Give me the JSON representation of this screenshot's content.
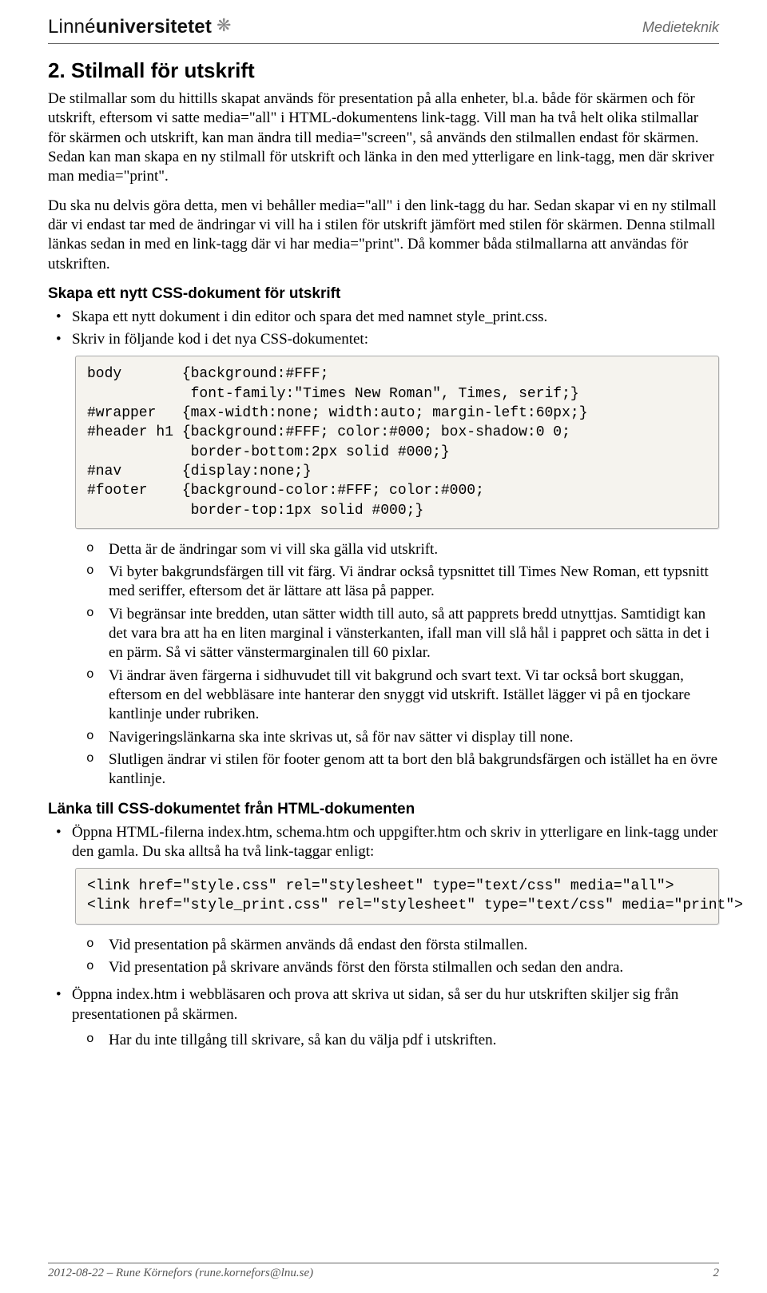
{
  "header": {
    "logo_thin": "Linné",
    "logo_bold": "universitetet",
    "flower_icon": "❋",
    "course": "Medieteknik"
  },
  "title": "2. Stilmall för utskrift",
  "para1": "De stilmallar som du hittills skapat används för presentation på alla enheter, bl.a. både för skärmen och för utskrift, eftersom vi satte media=\"all\" i HTML-dokumentens link-tagg. Vill man ha två helt olika stilmallar för skärmen och utskrift, kan man ändra till media=\"screen\", så används den stilmallen endast för skärmen. Sedan kan man skapa en ny stilmall för utskrift och länka in den med ytterligare en link-tagg, men där skriver man media=\"print\".",
  "para2": "Du ska nu delvis göra detta, men vi behåller media=\"all\" i den link-tagg du har. Sedan skapar vi en ny stilmall där vi endast tar med de ändringar vi vill ha i stilen för utskrift jämfört med stilen för skärmen. Denna stilmall länkas sedan in med en link-tagg där vi har media=\"print\". Då kommer båda stilmallarna att användas för utskriften.",
  "sub1": "Skapa ett nytt CSS-dokument för utskrift",
  "bullets1": [
    "Skapa ett nytt dokument i din editor och spara det med namnet style_print.css.",
    "Skriv in följande kod i det nya CSS-dokumentet:"
  ],
  "code1": "body       {background:#FFF;\n            font-family:\"Times New Roman\", Times, serif;}\n#wrapper   {max-width:none; width:auto; margin-left:60px;}\n#header h1 {background:#FFF; color:#000; box-shadow:0 0;\n            border-bottom:2px solid #000;}\n#nav       {display:none;}\n#footer    {background-color:#FFF; color:#000;\n            border-top:1px solid #000;}",
  "olist1": [
    "Detta är de ändringar som vi vill ska gälla vid utskrift.",
    "Vi byter bakgrundsfärgen till vit färg. Vi ändrar också typsnittet till Times New Roman, ett typsnitt med seriffer, eftersom det är lättare att läsa på papper.",
    "Vi begränsar inte bredden, utan sätter width till auto, så att papprets bredd utnyttjas. Samtidigt kan det vara bra att ha en liten marginal i vänsterkanten, ifall man vill slå hål i pappret och sätta in det i en pärm. Så vi sätter vänstermarginalen till 60 pixlar.",
    "Vi ändrar även färgerna i sidhuvudet till vit bakgrund och svart text. Vi tar också bort skuggan, eftersom en del webbläsare inte hanterar den snyggt vid utskrift. Istället lägger vi på en tjockare kantlinje under rubriken.",
    "Navigeringslänkarna ska inte skrivas ut, så för nav sätter vi display till none.",
    "Slutligen ändrar vi stilen för footer genom att ta bort den blå bakgrundsfärgen och istället ha en övre kantlinje."
  ],
  "sub2": "Länka till CSS-dokumentet från HTML-dokumenten",
  "bullets2": [
    "Öppna HTML-filerna index.htm, schema.htm och uppgifter.htm och skriv in ytterligare en link-tagg under den gamla. Du ska alltså ha två link-taggar enligt:"
  ],
  "code2": "<link href=\"style.css\" rel=\"stylesheet\" type=\"text/css\" media=\"all\">\n<link href=\"style_print.css\" rel=\"stylesheet\" type=\"text/css\" media=\"print\">",
  "olist2": [
    "Vid presentation på skärmen används då endast den första stilmallen.",
    "Vid presentation på skrivare används först den första stilmallen och sedan den andra."
  ],
  "bullets3": [
    "Öppna index.htm i webbläsaren och prova att skriva ut sidan, så ser du hur utskriften skiljer sig från presentationen på skärmen."
  ],
  "olist3": [
    "Har du inte tillgång till skrivare, så kan du välja pdf i utskriften."
  ],
  "footer": {
    "left": "2012-08-22 – Rune Körnefors (rune.kornefors@lnu.se)",
    "right": "2"
  }
}
